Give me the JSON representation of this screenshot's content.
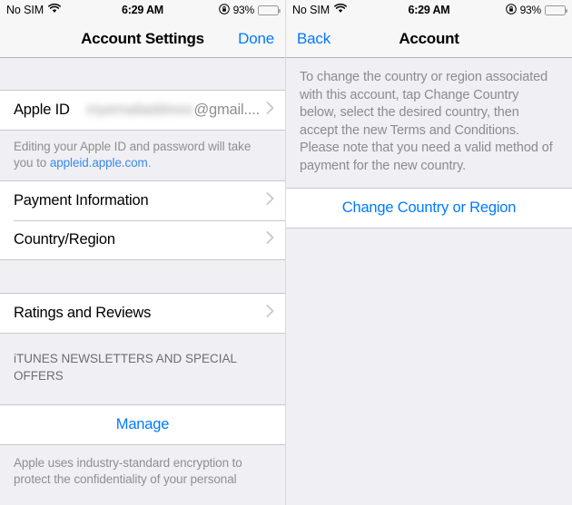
{
  "status_bar": {
    "carrier": "No SIM",
    "wifi_icon": "wifi-icon",
    "time": "6:29 AM",
    "rotation_lock_icon": "rotation-lock-icon",
    "battery_percent": "93%",
    "battery_level": 93,
    "battery_color": "#ffcc00"
  },
  "colors": {
    "accent_blue": "#007aff",
    "link_blue": "#3b8aec",
    "group_background": "#efeff4",
    "row_background": "#ffffff",
    "separator": "#c8c7cc",
    "secondary_text": "#8e8e93"
  },
  "left_screen": {
    "nav": {
      "title": "Account Settings",
      "right_button": "Done"
    },
    "apple_id_row": {
      "label": "Apple ID",
      "value_redacted": "myemailaddress",
      "value_visible": "@gmail....",
      "chevron_icon": "chevron-right-icon"
    },
    "apple_id_footnote": {
      "text_before": "Editing your Apple ID and password will take you to ",
      "link": "appleid.apple.com",
      "text_after": "."
    },
    "rows_group_2": [
      {
        "label": "Payment Information",
        "chevron_icon": "chevron-right-icon"
      },
      {
        "label": "Country/Region",
        "chevron_icon": "chevron-right-icon"
      }
    ],
    "rows_group_3": [
      {
        "label": "Ratings and Reviews",
        "chevron_icon": "chevron-right-icon"
      }
    ],
    "newsletters_header": "iTUNES NEWSLETTERS AND SPECIAL OFFERS",
    "manage_button": "Manage",
    "bottom_note": "Apple uses industry-standard encryption to protect the confidentiality of your personal"
  },
  "right_screen": {
    "nav": {
      "back_button": "Back",
      "title": "Account"
    },
    "description": "To change the country or region associated with this account, tap Change Country below, select the desired country, then accept the new Terms and Conditions. Please note that you need a valid method of payment for the new country.",
    "change_country_button": "Change Country or Region"
  }
}
